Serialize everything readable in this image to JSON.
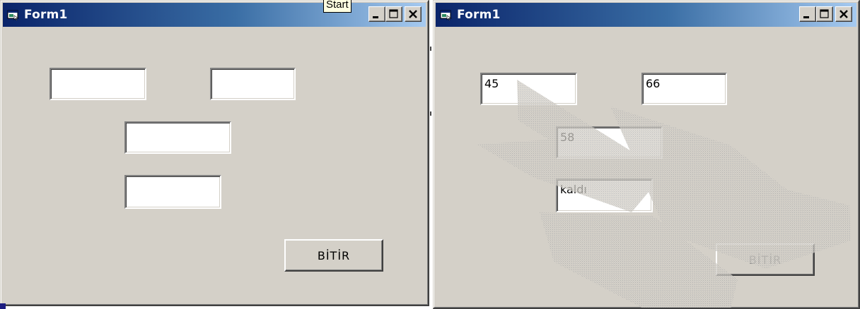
{
  "left_window": {
    "title": "Form1",
    "tooltip": "Start",
    "textboxes": [
      "",
      "",
      "",
      ""
    ],
    "button_label": "BİTİR"
  },
  "right_window": {
    "title": "Form1",
    "textboxes": [
      "45",
      "66",
      "58",
      "kaldı"
    ],
    "button_label": "BİTİR"
  },
  "colors": {
    "form_background": "#d4d0c8",
    "title_gradient_start": "#0a246a",
    "title_gradient_end": "#a6caf0"
  }
}
